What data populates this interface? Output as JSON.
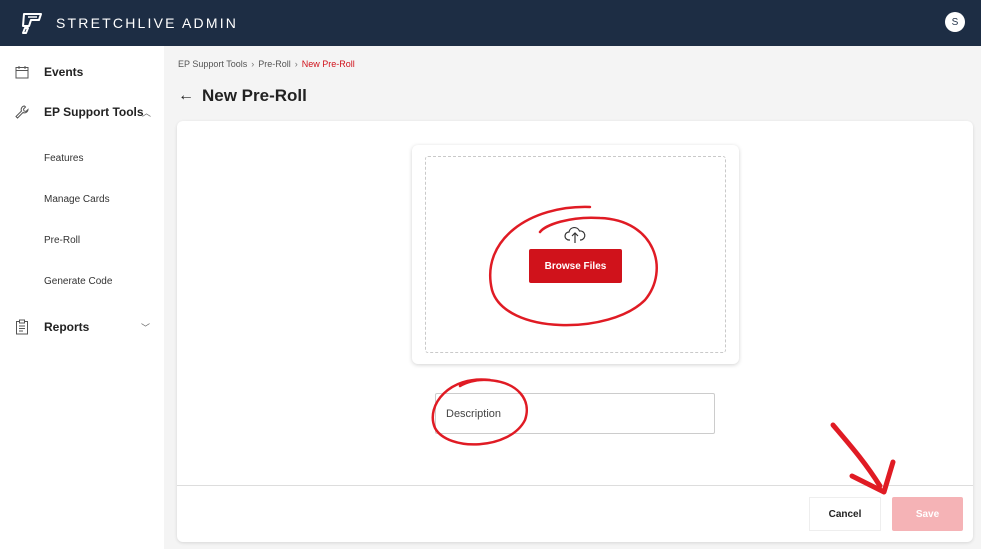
{
  "app": {
    "brand": "STRETCHLIVE ADMIN",
    "avatar_initial": "S"
  },
  "sidebar": {
    "events": "Events",
    "ep_support_tools": "EP Support Tools",
    "sub_items": [
      "Features",
      "Manage Cards",
      "Pre-Roll",
      "Generate Code"
    ],
    "reports": "Reports"
  },
  "breadcrumb": {
    "items": [
      "EP Support Tools",
      "Pre-Roll"
    ],
    "current": "New Pre-Roll",
    "separator": "›"
  },
  "page": {
    "title": "New Pre-Roll"
  },
  "upload": {
    "button_label": "Browse Files"
  },
  "form": {
    "description_placeholder": "Description",
    "description_value": ""
  },
  "footer": {
    "cancel_label": "Cancel",
    "save_label": "Save"
  },
  "colors": {
    "topbar": "#1d2d44",
    "accent": "#d0121b",
    "save_disabled": "#f5b3b6"
  },
  "icons": {
    "logo": "brand-logo-icon",
    "events": "calendar-icon",
    "tools": "wrench-icon",
    "reports": "clipboard-icon",
    "upload": "cloud-upload-icon",
    "back": "back-arrow-icon"
  }
}
